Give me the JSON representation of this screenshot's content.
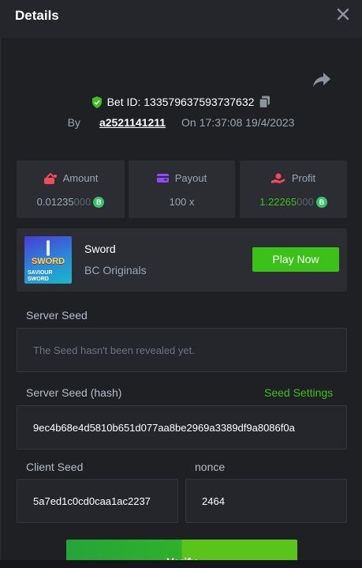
{
  "header": {
    "title": "Details"
  },
  "bet": {
    "id_label": "Bet ID: 133579637593737632",
    "by_label": "By",
    "user": "a2521141211",
    "on_label": "On",
    "datetime": "17:37:08 19/4/2023"
  },
  "stats": [
    {
      "label": "Amount",
      "value_main": "0.01235",
      "value_dim": "000",
      "icon": "bet-icon",
      "coin": true,
      "value_color": "#98a7b5"
    },
    {
      "label": "Payout",
      "value_main": "100 x",
      "value_dim": "",
      "icon": "wallet-icon",
      "coin": false
    },
    {
      "label": "Profit",
      "value_main": "1.22265",
      "value_dim": "000",
      "icon": "profit-icon",
      "coin": true
    }
  ],
  "game": {
    "thumb_title": "SWORD",
    "thumb_sub1": "SAVIOUR",
    "thumb_sub2": "SWORD",
    "name": "Sword",
    "provider": "BC Originals",
    "play_label": "Play Now"
  },
  "seeds": {
    "server_seed_label": "Server Seed",
    "server_seed_value": "The Seed hasn't been revealed yet.",
    "server_hash_label": "Server Seed (hash)",
    "seed_settings_label": "Seed Settings",
    "server_hash_value": "9ec4b68e4d5810b651d077aa8be2969a3389df9a8086f0a",
    "client_seed_label": "Client Seed",
    "client_seed_value": "5a7ed1c0cd0caa1ac2237",
    "nonce_label": "nonce",
    "nonce_value": "2464"
  },
  "verify_label": "Verify",
  "colors": {
    "accent_green": "#3bc117",
    "panel": "#1e2024",
    "card": "#2b2d33"
  }
}
